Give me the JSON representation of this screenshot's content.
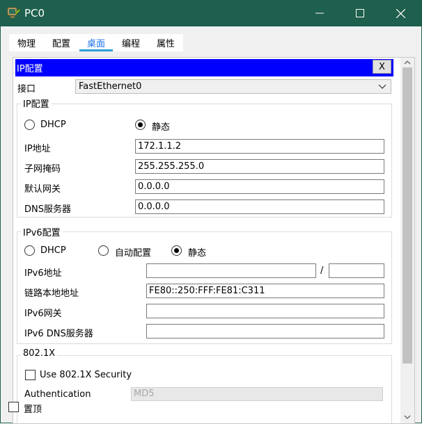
{
  "window": {
    "title": "PC0"
  },
  "tabs": [
    {
      "label": "物理"
    },
    {
      "label": "配置"
    },
    {
      "label": "桌面",
      "active": true
    },
    {
      "label": "编程"
    },
    {
      "label": "属性"
    }
  ],
  "ip_config": {
    "title": "IP配置",
    "close_label": "X",
    "interface_label": "接口",
    "interface_value": "FastEthernet0",
    "ipv4": {
      "group_title": "IP配置",
      "dhcp_label": "DHCP",
      "static_label": "静态",
      "mode": "static",
      "ip_label": "IP地址",
      "ip_value": "172.1.1.2",
      "mask_label": "子网掩码",
      "mask_value": "255.255.255.0",
      "gateway_label": "默认网关",
      "gateway_value": "0.0.0.0",
      "dns_label": "DNS服务器",
      "dns_value": "0.0.0.0"
    },
    "ipv6": {
      "group_title": "IPv6配置",
      "dhcp_label": "DHCP",
      "auto_label": "自动配置",
      "static_label": "静态",
      "mode": "static",
      "address_label": "IPv6地址",
      "address_value": "",
      "prefix_separator": "/",
      "prefix_value": "",
      "link_local_label": "链路本地地址",
      "link_local_value": "FE80::250:FFF:FE81:C311",
      "gateway_label": "IPv6网关",
      "gateway_value": "",
      "dns_label": "IPv6 DNS服务器",
      "dns_value": ""
    },
    "dot1x": {
      "group_title": "802.1X",
      "use_security_label": "Use 802.1X Security",
      "authentication_label": "Authentication",
      "authentication_value": "MD5"
    }
  },
  "footer": {
    "always_on_top_label": "置顶"
  },
  "colors": {
    "titlebar": "#1e5f4d",
    "inner_titlebar": "#0000ff",
    "active_tab": "#2e9fd6"
  }
}
